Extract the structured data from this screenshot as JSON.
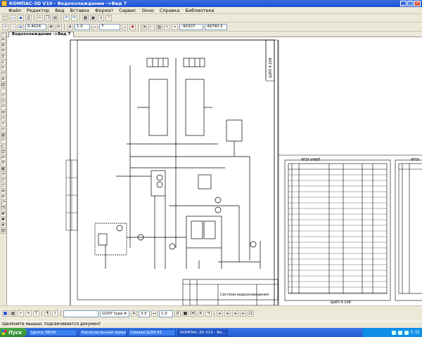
{
  "window": {
    "title": "КОМПАС-3D V10 - Водоохлаждение ->Вид 7"
  },
  "menu": {
    "items": [
      "Файл",
      "Редактор",
      "Вид",
      "Вставка",
      "Формат",
      "Сервис",
      "Окно",
      "Справка",
      "Библиотеки"
    ]
  },
  "toolbar2": {
    "zoom": "0.4026",
    "step": "1.0",
    "layer_field": "7",
    "coord_x": "-90307.",
    "coord_y": "49760.5"
  },
  "document_tab": {
    "label": "Водоохлаждение ->Вид 7"
  },
  "drawing": {
    "stamp_text_vertical": "ШИЛ 4.108",
    "title_block_text": "Система водоохлаждения",
    "spec_title_1": "ФПЭ УНИП",
    "spec_title_2": "ФПЭ",
    "spec_bottom": "ШИЛ 4.108"
  },
  "bottom_toolbar": {
    "font": "GOST type A",
    "font_size": "3.5",
    "scale": "1.0"
  },
  "statusbar": {
    "text": "Щелкните мышью, подсвечивается документ"
  },
  "taskbar": {
    "start": "Пуск",
    "tasks": [
      "Центр ЛЕОН",
      "Распечатанный проект...",
      "Связки ШЛ4.41",
      "КОМПАС-3D V10 - Во..."
    ],
    "clock": "5:32"
  }
}
